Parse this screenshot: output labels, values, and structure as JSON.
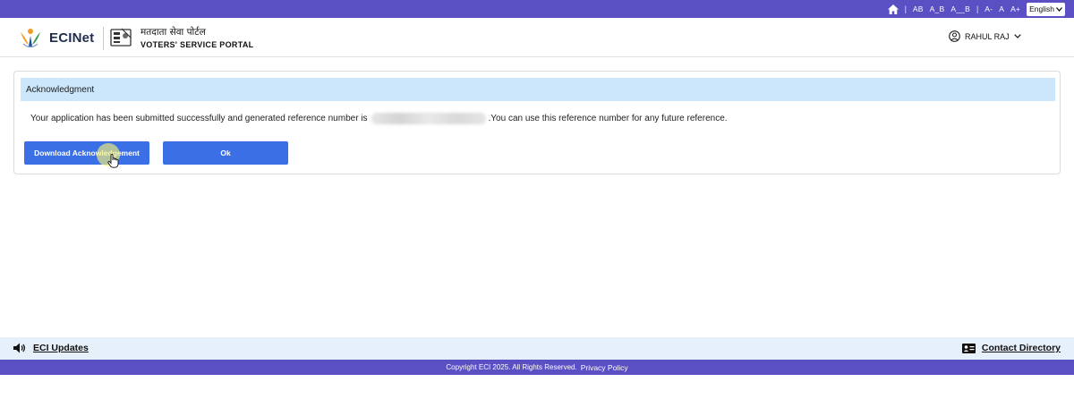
{
  "topbar": {
    "font_controls": [
      "AB",
      "A_B",
      "A__B"
    ],
    "size_controls": [
      "A-",
      "A",
      "A+"
    ],
    "language": "English"
  },
  "header": {
    "brand": "ECINet",
    "portal_hindi": "मतदाता सेवा पोर्टल",
    "portal_english": "VOTERS' SERVICE PORTAL",
    "user_name": "RAHUL RAJ"
  },
  "acknowledgment": {
    "title": "Acknowledgment",
    "message_before": "Your application has been submitted successfully and generated reference number is",
    "message_after": ".You can use this reference number for any future reference.",
    "download_label": "Download Acknowledgement",
    "ok_label": "Ok"
  },
  "footer": {
    "updates_label": "ECI Updates",
    "contact_label": "Contact Directory",
    "copyright": "Copyright ECI 2025. All Rights Reserved.",
    "privacy": "Privacy Policy"
  },
  "colors": {
    "topbar": "#5b4fc4",
    "card_header": "#cce6fb",
    "button": "#3a6fe6",
    "footer_strip": "#e6f0fa"
  }
}
